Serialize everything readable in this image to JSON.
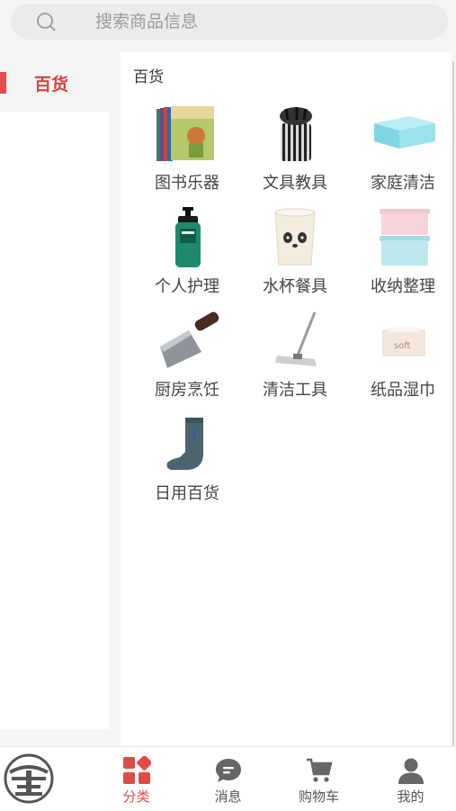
{
  "search": {
    "placeholder": "搜索商品信息"
  },
  "sidebar": {
    "items": [
      {
        "label": "百货",
        "active": true
      }
    ]
  },
  "category": {
    "title": "百货",
    "items": [
      {
        "label": "图书乐器",
        "icon": "books-image"
      },
      {
        "label": "文具教具",
        "icon": "pens-image"
      },
      {
        "label": "家庭清洁",
        "icon": "blue-box-image"
      },
      {
        "label": "个人护理",
        "icon": "pump-bottle-image"
      },
      {
        "label": "水杯餐具",
        "icon": "panda-cup-image"
      },
      {
        "label": "收纳整理",
        "icon": "storage-box-image"
      },
      {
        "label": "厨房烹饪",
        "icon": "cleaver-image"
      },
      {
        "label": "清洁工具",
        "icon": "mop-image"
      },
      {
        "label": "纸品湿巾",
        "icon": "tissue-box-image"
      },
      {
        "label": "日用百货",
        "icon": "sock-image"
      }
    ]
  },
  "tabbar": {
    "items": [
      {
        "label": "",
        "icon": "logo-icon"
      },
      {
        "label": "分类",
        "icon": "category-icon",
        "active": true
      },
      {
        "label": "消息",
        "icon": "message-icon"
      },
      {
        "label": "购物车",
        "icon": "cart-icon"
      },
      {
        "label": "我的",
        "icon": "user-icon"
      }
    ]
  },
  "colors": {
    "accent": "#e04b44",
    "background": "#f5f5f5"
  }
}
